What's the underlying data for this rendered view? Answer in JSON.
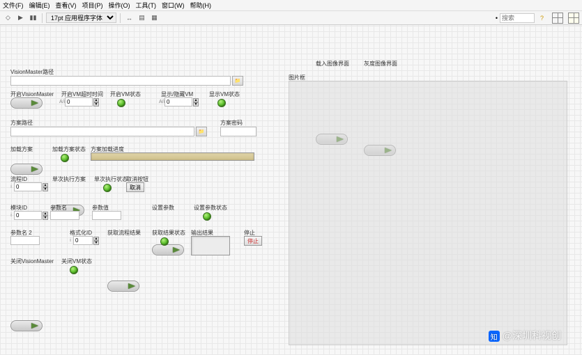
{
  "menu": {
    "file": "文件(F)",
    "edit": "编辑(E)",
    "view": "查看(V)",
    "project": "项目(P)",
    "operate": "操作(O)",
    "tools": "工具(T)",
    "window": "窗口(W)",
    "help": "帮助(H)"
  },
  "toolbar": {
    "font_size": "17pt 应用程序字体",
    "search_label": "搜索",
    "search_ph": ""
  },
  "vm_path": {
    "label": "VisionMaster路径",
    "value": "",
    "browse": "📁"
  },
  "open_vm": {
    "label": "开启VisionMaster"
  },
  "open_timeout": {
    "label": "开启VM超时时间",
    "value": "0"
  },
  "open_status": {
    "label": "开启VM状态"
  },
  "show_hide_vm": {
    "label": "显示/隐藏VM",
    "value": "0"
  },
  "show_status": {
    "label": "显示VM状态"
  },
  "scheme_path": {
    "label": "方案路径",
    "value": "",
    "browse": "📁"
  },
  "scheme_pwd": {
    "label": "方案密码",
    "value": ""
  },
  "load_scheme": {
    "label": "加载方案"
  },
  "load_scheme_status": {
    "label": "加载方案状态"
  },
  "scheme_progress": {
    "label": "方案加载进度"
  },
  "process_id": {
    "label": "流程ID",
    "value": "0"
  },
  "single_exec": {
    "label": "单次执行方案"
  },
  "single_exec_status": {
    "label": "单次执行状态"
  },
  "cancel_btn": {
    "label": "取消按钮",
    "text": "取消"
  },
  "module_id": {
    "label": "模块ID",
    "value": "0"
  },
  "param_name": {
    "label": "参数名",
    "value": ""
  },
  "param_value": {
    "label": "参数值",
    "value": ""
  },
  "set_param": {
    "label": "设置参数"
  },
  "set_param_status": {
    "label": "设置参数状态"
  },
  "param_name2": {
    "label": "参数名 2",
    "value": ""
  },
  "format_id": {
    "label": "格式化ID",
    "value": "0"
  },
  "get_result": {
    "label": "获取流程结果"
  },
  "get_status": {
    "label": "获取结果状态"
  },
  "output": {
    "label": "输出结果"
  },
  "stop": {
    "label": "停止",
    "text": "停止"
  },
  "close_vm": {
    "label": "关闭VisionMaster"
  },
  "close_status": {
    "label": "关闭VM状态"
  },
  "panel": {
    "label": "图片框",
    "load_img": "载入图像界面",
    "gray_img": "灰度图像界面"
  },
  "watermark": {
    "text": "@深圳科视创",
    "badge": "知"
  }
}
